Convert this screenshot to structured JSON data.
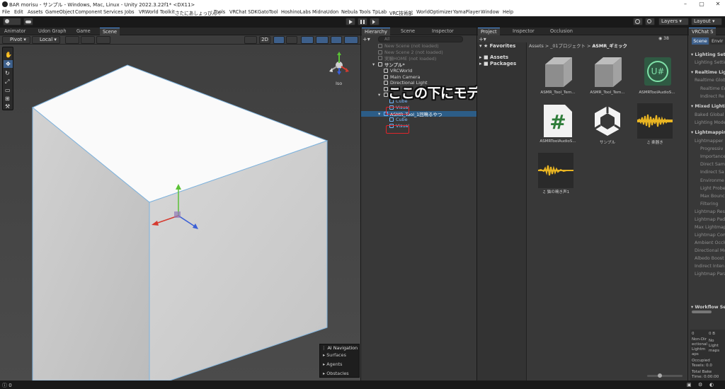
{
  "title_bar": {
    "text": "BAR morisu - サンプル - Windows, Mac, Linux - Unity 2022.3.22f1* <DX11>"
  },
  "menu": [
    "File",
    "Edit",
    "Assets",
    "GameObject",
    "Component",
    "Services",
    "Jobs",
    "VRWorld Toolkit",
    "さたにあしょっぴんぐ",
    "Tools",
    "VRChat SDK",
    "GatoTool",
    "HoshinoLabs",
    "MidnaUdon",
    "Nebula Tools",
    "TpLab",
    "VRC技術部",
    "WorldOptimizer",
    "YamaPlayer",
    "Window",
    "Help"
  ],
  "toolbar": {
    "layers": "Layers",
    "layout": "Layout"
  },
  "scene_tabs": [
    "Animator",
    "Udon Graph",
    "Game",
    "Scene"
  ],
  "scene_toolbar": {
    "pivot": "Pivot",
    "local": "Local",
    "mode2d": "2D",
    "gizmo_label": "Iso"
  },
  "hierarchy": {
    "tabs": [
      "Hierarchy",
      "Scene",
      "Inspector"
    ],
    "search_placeholder": "All",
    "rows": [
      {
        "label": "New Scene (not loaded)",
        "indent": 0,
        "dim": true
      },
      {
        "label": "New Scene 2 (not loaded)",
        "indent": 0,
        "dim": true
      },
      {
        "label": "実験HOME (not loaded)",
        "indent": 0,
        "dim": true
      },
      {
        "label": "サンプル*",
        "indent": 0,
        "dim": false,
        "bold": true
      },
      {
        "label": "VRCWorld",
        "indent": 1,
        "dim": false
      },
      {
        "label": "Main Camera",
        "indent": 1,
        "dim": false
      },
      {
        "label": "Directional Light",
        "indent": 1,
        "dim": false
      },
      {
        "label": "",
        "indent": 1,
        "dim": false
      },
      {
        "label": "",
        "indent": 1,
        "dim": false
      },
      {
        "label": "Cube",
        "indent": 2,
        "dim": false,
        "blue": true
      },
      {
        "label": "Visual",
        "indent": 2,
        "dim": false,
        "blue": true
      },
      {
        "label": "ASMR_Tool_1回鳴るやつ",
        "indent": 1,
        "dim": false,
        "blue": true
      },
      {
        "label": "Cube",
        "indent": 2,
        "dim": false,
        "blue": true
      },
      {
        "label": "Visual",
        "indent": 2,
        "dim": false,
        "blue": true
      }
    ]
  },
  "overlay_caption": "ここの下にモデルを入れる",
  "project": {
    "tabs": [
      "Project",
      "Inspector",
      "Occlusion"
    ],
    "favorites": "Favorites",
    "tree": [
      "Assets",
      "Packages"
    ],
    "breadcrumb": [
      "Assets",
      "_01プロジェクト",
      "ASMR_ギミック"
    ],
    "count": "38",
    "assets": [
      {
        "label": "ASMR_Tool_Tem...",
        "kind": "cube"
      },
      {
        "label": "ASMR_Tool_Tem...",
        "kind": "cube"
      },
      {
        "label": "ASMRToolAudioS...",
        "kind": "udon"
      },
      {
        "label": "ASMRToolAudioS...",
        "kind": "csharp"
      },
      {
        "label": "サンプル",
        "kind": "unity"
      },
      {
        "label": "♫ 楽器き",
        "kind": "audio"
      },
      {
        "label": "♫ 猫の鳴き声1",
        "kind": "audio"
      }
    ]
  },
  "lighting": {
    "title": "VRChat S",
    "tabs": [
      "Scene",
      "Envir"
    ],
    "rows": [
      {
        "t": "Lighting Setti",
        "head": true
      },
      {
        "t": "Lighting Settin",
        "head": false
      },
      {
        "t": "Realtime Lighti",
        "head": true
      },
      {
        "t": "Realtime Glob",
        "head": false
      },
      {
        "t": "Realtime En",
        "head": false
      },
      {
        "t": "Indirect Re",
        "head": false
      },
      {
        "t": "Mixed Lighting",
        "head": true
      },
      {
        "t": "Baked Global",
        "head": false
      },
      {
        "t": "Lighting Mode",
        "head": false
      },
      {
        "t": "Lightmapping S",
        "head": true
      },
      {
        "t": "Lightmapper",
        "head": false
      },
      {
        "t": "Progressiv",
        "head": false
      },
      {
        "t": "Importance",
        "head": false
      },
      {
        "t": "Direct Sam",
        "head": false
      },
      {
        "t": "Indirect Sa",
        "head": false
      },
      {
        "t": "Environme",
        "head": false
      },
      {
        "t": "Light Probe",
        "head": false
      },
      {
        "t": "Max Bounc",
        "head": false
      },
      {
        "t": "Filtering",
        "head": false
      },
      {
        "t": "Lightmap Reso",
        "head": false
      },
      {
        "t": "Lightmap Pado",
        "head": false
      },
      {
        "t": "Max Lightmap",
        "head": false
      },
      {
        "t": "Lightmap Com",
        "head": false
      },
      {
        "t": "Ambient Occlu",
        "head": false
      },
      {
        "t": "Directional Mo",
        "head": false
      },
      {
        "t": "Albedo Boost",
        "head": false
      },
      {
        "t": "Indirect Inten",
        "head": false
      },
      {
        "t": "Lightmap Para",
        "head": false
      },
      {
        "t": "Workflow Se",
        "head": true
      }
    ],
    "stats": [
      "0",
      "0 B",
      "Non-Dir",
      "No",
      "ectional",
      "Light",
      "Lightm",
      "maps",
      "aps",
      "Occupied",
      "Texels: 0.0",
      "Total Bake",
      "Time: 0:00:00"
    ]
  },
  "ai_navigation": {
    "title": "AI Navigation",
    "items": [
      "Surfaces",
      "Agents",
      "Obstacles"
    ]
  },
  "status": {
    "count": "0"
  }
}
